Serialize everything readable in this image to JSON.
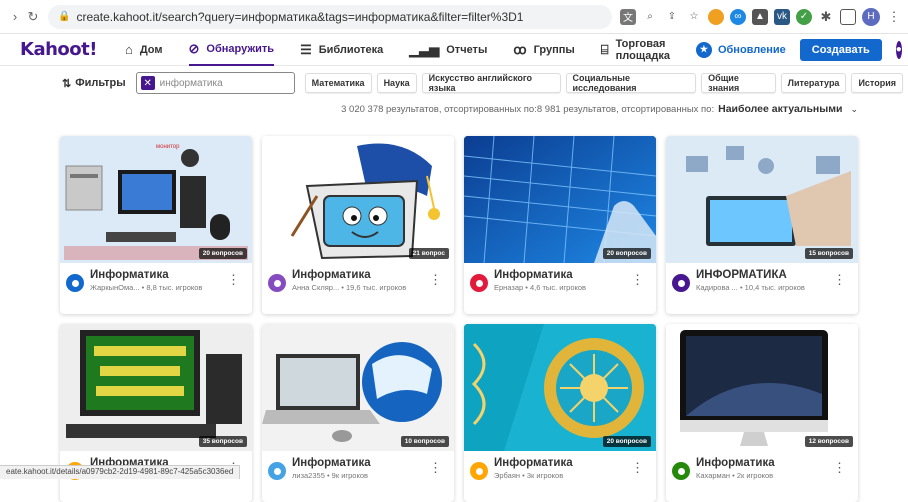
{
  "browser": {
    "url": "create.kahoot.it/search?query=информатика&tags=информатика&filter=filter%3D1",
    "profile_initial": "Н"
  },
  "nav": {
    "logo": "Kahoot!",
    "items": [
      {
        "label": "Дом",
        "icon": "home-icon"
      },
      {
        "label": "Обнаружить",
        "icon": "compass-icon",
        "active": true
      },
      {
        "label": "Библиотека",
        "icon": "list-icon"
      },
      {
        "label": "Отчеты",
        "icon": "bar-chart-icon"
      },
      {
        "label": "Группы",
        "icon": "group-icon"
      },
      {
        "label": "Торговая площадка",
        "icon": "store-icon"
      }
    ],
    "upgrade_label": "Обновление",
    "create_label": "Создавать"
  },
  "filters": {
    "label": "Фильтры",
    "search_value": "информатика",
    "chips": [
      "Математика",
      "Наука",
      "Искусство английского языка",
      "Социальные исследования",
      "Общие знания",
      "Литература",
      "История"
    ]
  },
  "results": {
    "summary": "3 020 378 результатов, отсортированных по:8 981 результатов, отсортированных по:",
    "sort_label": "Наиболее актуальными"
  },
  "cards": [
    {
      "title": "Информатика",
      "author": "ЖаркынОма...",
      "plays": "8,8 тыс. игроков",
      "questions": "20 вопросов",
      "avatar_color": "#1368ce"
    },
    {
      "title": "Информатика",
      "author": "Анна Скляр...",
      "plays": "19,6 тыс. игроков",
      "questions": "21 вопрос",
      "avatar_color": "#864cbf"
    },
    {
      "title": "Информатика",
      "author": "Ерназар",
      "plays": "4,6 тыс. игроков",
      "questions": "20 вопросов",
      "avatar_color": "#e21b3c"
    },
    {
      "title": "ИНФОРМАТИКА",
      "author": "Кадирова ...",
      "plays": "10,4 тыс. игроков",
      "questions": "15 вопросов",
      "avatar_color": "#46178f"
    },
    {
      "title": "Информатика",
      "author": "",
      "plays": "",
      "questions": "35 вопросов",
      "avatar_color": "#ffa602"
    },
    {
      "title": "Информатика",
      "author": "лиза2355",
      "plays": "9к игроков",
      "questions": "10 вопросов",
      "avatar_color": "#45a3e5"
    },
    {
      "title": "Информатика",
      "author": "Эрбаян",
      "plays": "3к игроков",
      "questions": "20 вопросов",
      "avatar_color": "#ffa602"
    },
    {
      "title": "Информатика",
      "author": "Кахарман",
      "plays": "2к игроков",
      "questions": "12 вопросов",
      "avatar_color": "#26890c"
    }
  ],
  "status_url": "eate.kahoot.it/details/a0979cb2-2d19-4981-89c7-425a5c3036ed"
}
